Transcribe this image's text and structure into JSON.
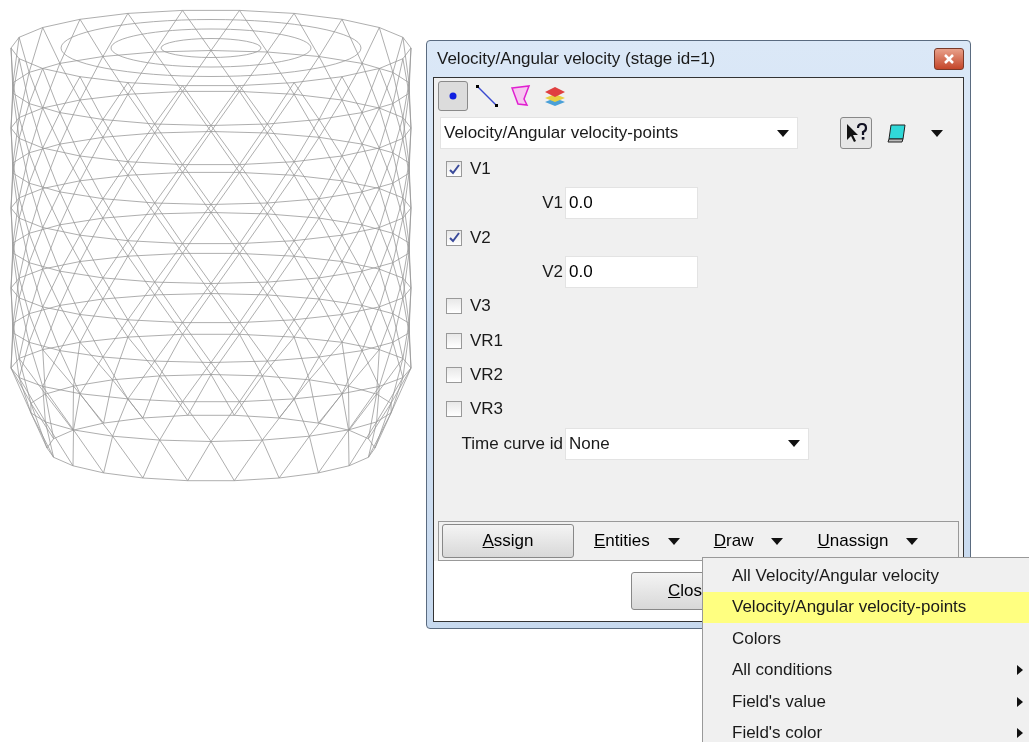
{
  "window": {
    "title": "Velocity/Angular velocity (stage id=1)"
  },
  "entity_types": [
    {
      "kind": "point",
      "selected": true
    },
    {
      "kind": "line",
      "selected": false
    },
    {
      "kind": "surface",
      "selected": false
    },
    {
      "kind": "layers",
      "selected": false
    }
  ],
  "condition_select": {
    "value": "Velocity/Angular velocity-points"
  },
  "fields": [
    {
      "kind": "checkbox",
      "label": "V1",
      "checked": true
    },
    {
      "kind": "value",
      "label": "V1",
      "value": "0.0"
    },
    {
      "kind": "checkbox",
      "label": "V2",
      "checked": true
    },
    {
      "kind": "value",
      "label": "V2",
      "value": "0.0"
    },
    {
      "kind": "checkbox",
      "label": "V3",
      "checked": false
    },
    {
      "kind": "checkbox",
      "label": "VR1",
      "checked": false
    },
    {
      "kind": "checkbox",
      "label": "VR2",
      "checked": false
    },
    {
      "kind": "checkbox",
      "label": "VR3",
      "checked": false
    },
    {
      "kind": "select",
      "label": "Time curve id",
      "value": "None"
    }
  ],
  "actions": [
    {
      "kind": "button",
      "label": "Assign"
    },
    {
      "kind": "menu",
      "label": "Entities"
    },
    {
      "kind": "menu",
      "label": "Draw"
    },
    {
      "kind": "menu",
      "label": "Unassign"
    }
  ],
  "close_button": {
    "label": "Clos"
  },
  "draw_menu": {
    "items": [
      {
        "label": "All Velocity/Angular velocity",
        "selected": false,
        "submenu": false
      },
      {
        "label": "Velocity/Angular velocity-points",
        "selected": true,
        "submenu": false
      },
      {
        "label": "Colors",
        "selected": false,
        "submenu": false
      },
      {
        "label": "All conditions",
        "selected": false,
        "submenu": true
      },
      {
        "label": "Field's value",
        "selected": false,
        "submenu": true
      },
      {
        "label": "Field's color",
        "selected": false,
        "submenu": true
      }
    ]
  }
}
